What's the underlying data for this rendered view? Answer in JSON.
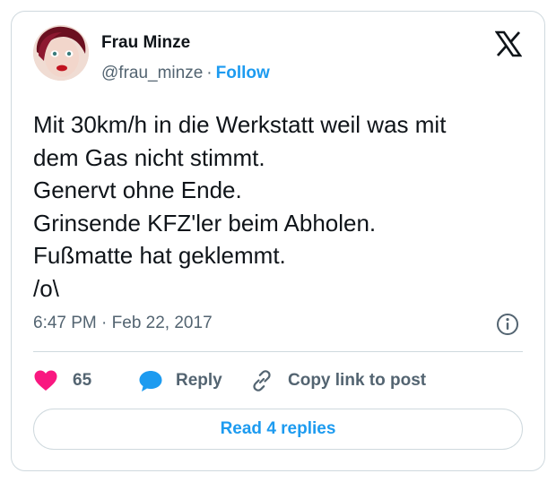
{
  "user": {
    "name": "Frau Minze",
    "handle": "@frau_minze",
    "separator": "·",
    "follow_label": "Follow"
  },
  "tweet": {
    "lines": [
      "Mit 30km/h in die Werkstatt weil was mit",
      "dem Gas nicht stimmt.",
      "Genervt ohne Ende.",
      "Grinsende KFZ'ler beim Abholen.",
      "Fußmatte hat geklemmt.",
      "/o\\"
    ],
    "time": "6:47 PM",
    "separator": "·",
    "date": "Feb 22, 2017"
  },
  "actions": {
    "like_count": "65",
    "reply_label": "Reply",
    "copy_label": "Copy link to post"
  },
  "read_replies_label": "Read 4 replies",
  "icons": {
    "avatar": "avatar-photo",
    "logo": "x-logo-icon",
    "info": "info-icon",
    "like": "heart-icon",
    "reply": "speech-bubble-icon",
    "copy": "link-icon"
  },
  "colors": {
    "accent": "#1d9bf0",
    "like": "#f91880",
    "muted": "#536471",
    "text": "#0f1419",
    "border": "#cfd9de"
  }
}
